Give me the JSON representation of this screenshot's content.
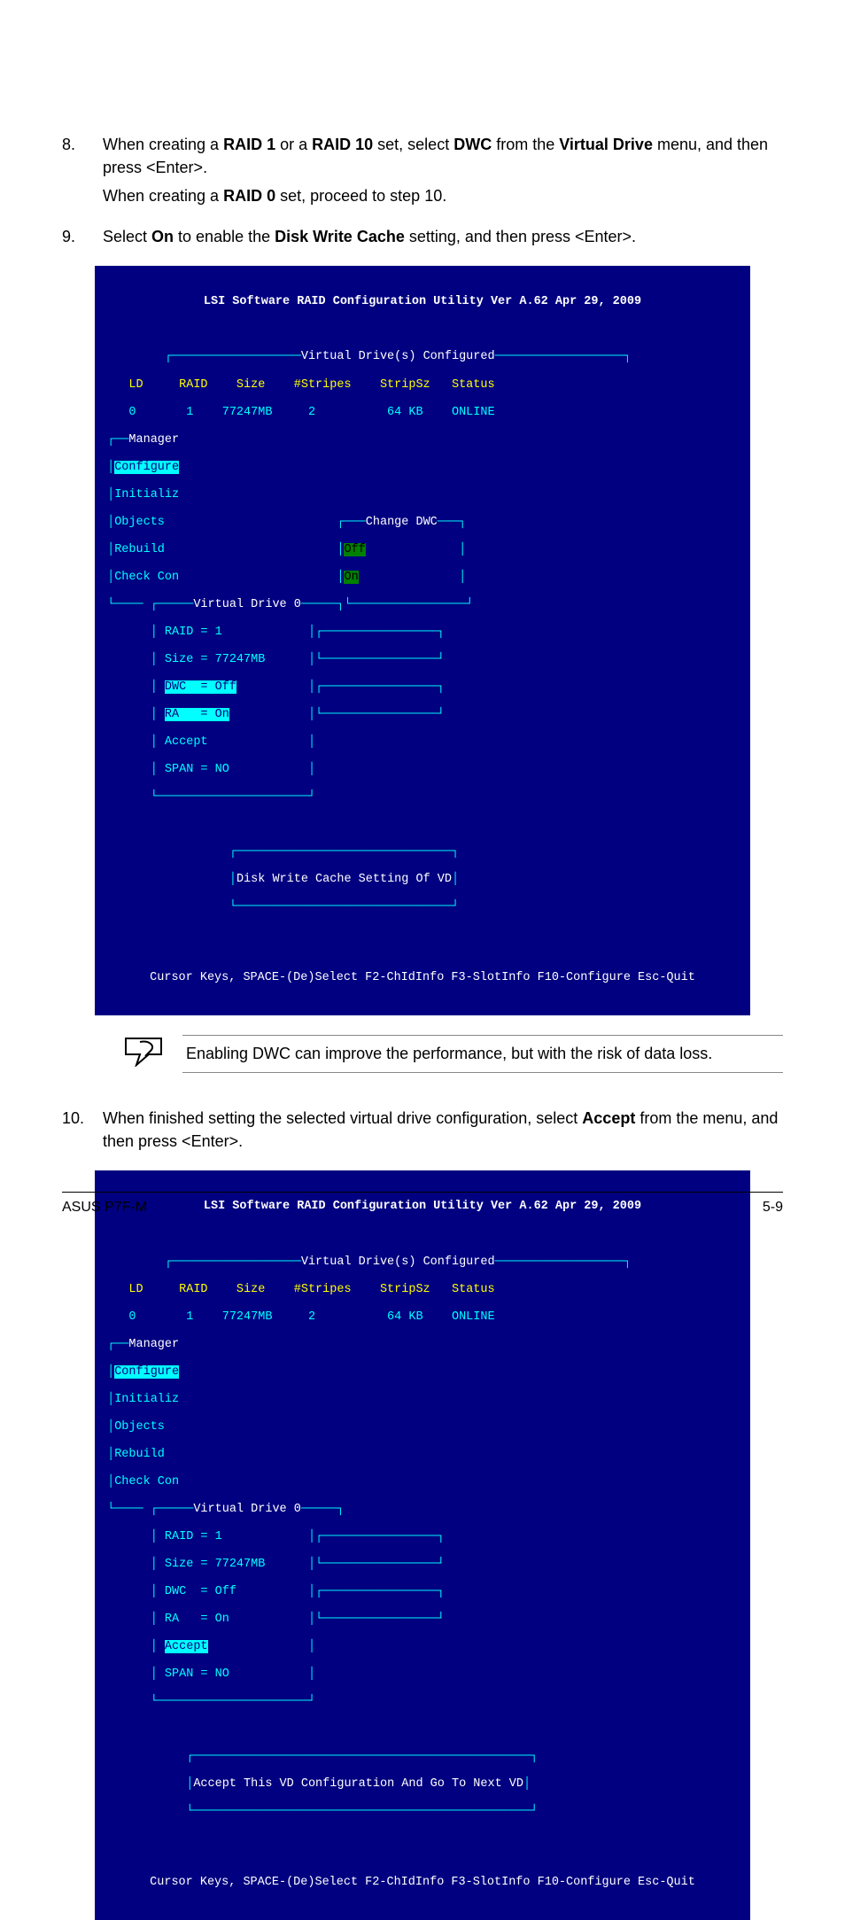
{
  "steps": {
    "s8": {
      "num": "8.",
      "line1a": "When creating a ",
      "b1": "RAID 1",
      "line1b": " or a ",
      "b2": "RAID 10",
      "line1c": " set, select ",
      "b3": "DWC",
      "line1d": " from the ",
      "b4": "Virtual Drive",
      "line1e": " menu, and then press <Enter>.",
      "line2a": "When creating a ",
      "b5": "RAID 0",
      "line2b": " set, proceed to step 10."
    },
    "s9": {
      "num": "9.",
      "line1a": "Select ",
      "b1": "On",
      "line1b": " to enable the ",
      "b2": "Disk Write Cache",
      "line1c": " setting, and then press <Enter>."
    },
    "s10": {
      "num": "10.",
      "line1a": "When finished setting the selected virtual drive configuration, select ",
      "b1": "Accept",
      "line1b": " from the menu, and then press <Enter>."
    }
  },
  "note": "Enabling DWC can improve the performance, but with the risk of data loss.",
  "bios1": {
    "title": "LSI Software RAID Configuration Utility Ver A.62 Apr 29, 2009",
    "panel_title": "Virtual Drive(s) Configured",
    "hdr": "    LD     RAID    Size    #Stripes    StripSz   Status",
    "row": "    0       1    77247MB     2          64 KB    ONLINE",
    "menu": [
      "Manager",
      "Configure",
      "Initializ",
      "Objects",
      "Rebuild",
      "Check Con"
    ],
    "dwc_title": "Change DWC",
    "dwc_off": "Off",
    "dwc_on": "On",
    "vd_title": "Virtual Drive 0",
    "vd": [
      "RAID = 1",
      "Size = 77247MB",
      "DWC  = Off",
      "RA   = On",
      "Accept",
      "SPAN = NO"
    ],
    "status": "Disk Write Cache Setting Of VD",
    "help": "Cursor Keys, SPACE-(De)Select F2-ChIdInfo F3-SlotInfo F10-Configure Esc-Quit"
  },
  "bios2": {
    "title": "LSI Software RAID Configuration Utility Ver A.62 Apr 29, 2009",
    "panel_title": "Virtual Drive(s) Configured",
    "hdr": "    LD     RAID    Size    #Stripes    StripSz   Status",
    "row": "    0       1    77247MB     2          64 KB    ONLINE",
    "menu": [
      "Manager",
      "Configure",
      "Initializ",
      "Objects",
      "Rebuild",
      "Check Con"
    ],
    "vd_title": "Virtual Drive 0",
    "vd": [
      "RAID = 1",
      "Size = 77247MB",
      "DWC  = Off",
      "RA   = On",
      "Accept",
      "SPAN = NO"
    ],
    "status": "Accept This VD Configuration And Go To Next VD",
    "help": "Cursor Keys, SPACE-(De)Select F2-ChIdInfo F3-SlotInfo F10-Configure Esc-Quit"
  },
  "footer": {
    "left": "ASUS P7F-M",
    "right": "5-9"
  }
}
